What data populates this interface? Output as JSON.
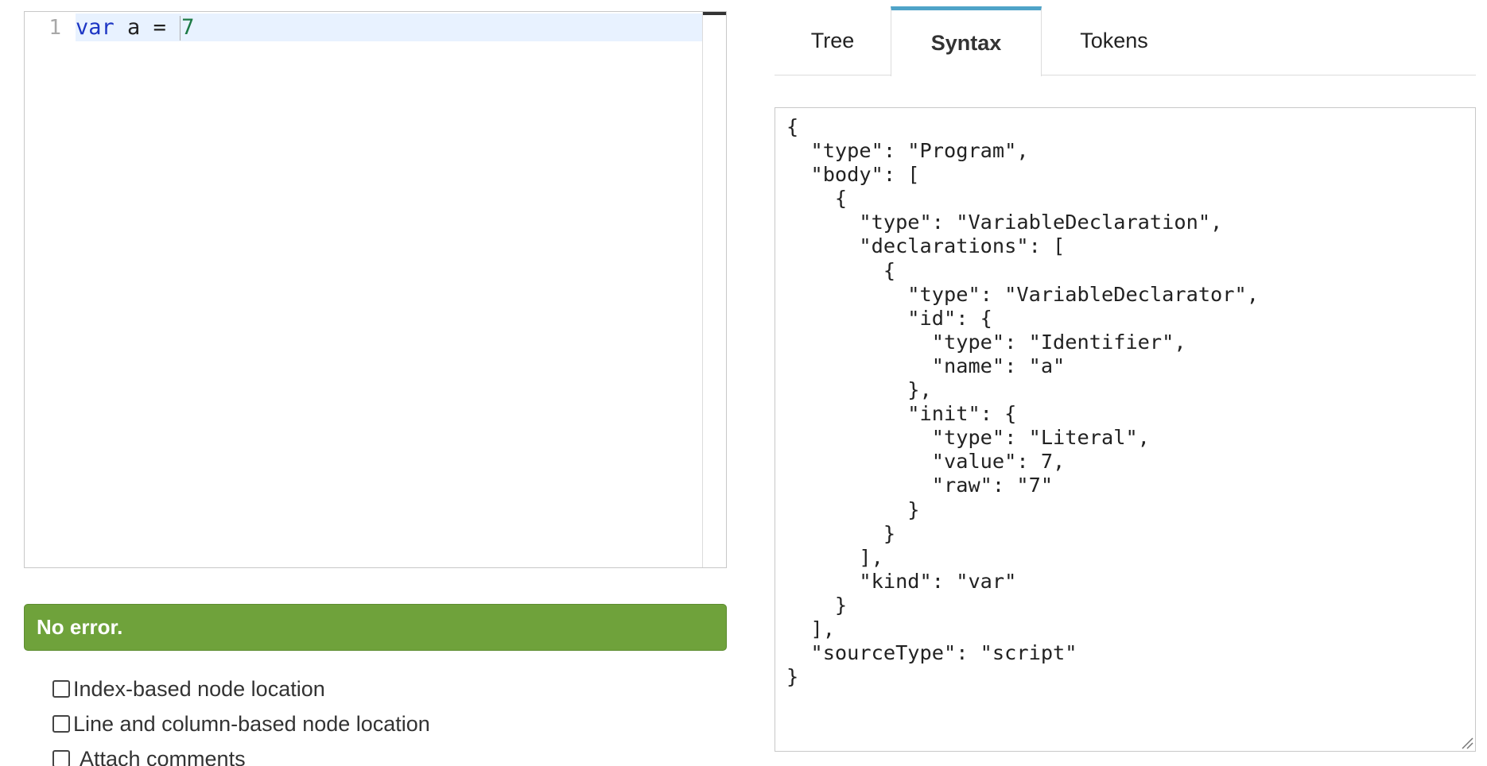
{
  "editor": {
    "line_number": "1",
    "tokens": {
      "keyword": "var",
      "identifier": "a",
      "operator": "=",
      "number": "7"
    }
  },
  "status": {
    "message": "No error."
  },
  "options": [
    {
      "label": "Index-based node location",
      "checked": false
    },
    {
      "label": "Line and column-based node location",
      "checked": false
    },
    {
      "label": "Attach comments",
      "checked": false
    }
  ],
  "tabs": [
    {
      "label": "Tree",
      "active": false
    },
    {
      "label": "Syntax",
      "active": true
    },
    {
      "label": "Tokens",
      "active": false
    }
  ],
  "colors": {
    "status_bg": "#6fa23b",
    "active_tab_accent": "#4fa3c8",
    "keyword": "#1d36c4",
    "number": "#1c7a45",
    "active_line": "#e8f2ff"
  },
  "output": {
    "text": "{\n  \"type\": \"Program\",\n  \"body\": [\n    {\n      \"type\": \"VariableDeclaration\",\n      \"declarations\": [\n        {\n          \"type\": \"VariableDeclarator\",\n          \"id\": {\n            \"type\": \"Identifier\",\n            \"name\": \"a\"\n          },\n          \"init\": {\n            \"type\": \"Literal\",\n            \"value\": 7,\n            \"raw\": \"7\"\n          }\n        }\n      ],\n      \"kind\": \"var\"\n    }\n  ],\n  \"sourceType\": \"script\"\n}"
  }
}
